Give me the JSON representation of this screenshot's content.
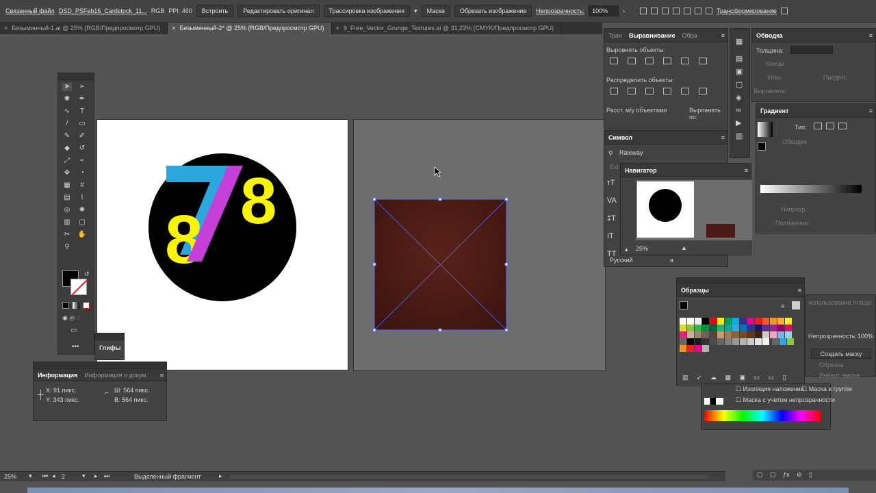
{
  "control_bar": {
    "linked_file": "Связанный файл",
    "file_name": "DSD_PSFeb16_Cardstock_11...",
    "color_mode": "RGB",
    "ppi": "PPI: 460",
    "embed": "Встроить",
    "edit_original": "Редактировать оригинал",
    "image_trace": "Трассировка изображения",
    "mask": "Маска",
    "crop_image": "Обрезать изображение",
    "opacity_label": "Непрозрачность:",
    "opacity_value": "100%",
    "transform": "Трансформирование"
  },
  "tabs": [
    {
      "label": "Безымянный-1.ai @ 25% (RGB/Предпросмотр GPU)",
      "active": false
    },
    {
      "label": "Безымянный-2* @ 25% (RGB/Предпросмотр GPU)",
      "active": true
    },
    {
      "label": "9_Free_Vector_Grunge_Textures.ai @ 31,23% (CMYK/Предпросмотр GPU)",
      "active": false
    }
  ],
  "artboard1": {
    "logo_text_seven": "7",
    "logo_text_eight_a": "8",
    "logo_text_eight_b": "8"
  },
  "glyphs_panel": {
    "title": "Глифы"
  },
  "info_panel": {
    "tab1": "Информация",
    "tab2": "Информация о докум",
    "x": "X:  91 пикс.",
    "y": "Y:  343 пикс.",
    "w": "Ш:  564 пикс.",
    "h": "В:  564 пикс."
  },
  "align_panel": {
    "tab1": "Тран",
    "tab2": "Выравнивание",
    "tab3": "Обра",
    "align_objects": "Выровнять объекты:",
    "distribute_objects": "Распределить объекты:",
    "spacing": "Расст. м/у объектами",
    "align_to": "Выровнять по:"
  },
  "stroke_panel": {
    "title": "Обводка",
    "thickness": "Толщина:",
    "caps": "Концы",
    "corners": "Углы",
    "limit": "Предел:",
    "align": "Выровнять:"
  },
  "gradient_panel": {
    "title": "Градиент",
    "type": "Тип:",
    "stroke": "Обводка",
    "opacity": "Непрозр.:",
    "location": "Положение:"
  },
  "symbol_panel": {
    "title": "Символ",
    "font": "Raleway",
    "ext": "Ext",
    "language": "Русский",
    "aa": "a"
  },
  "navigator_panel": {
    "title": "Навигатор",
    "zoom": "25%"
  },
  "swatches_panel": {
    "title": "Образцы"
  },
  "transparency_panel": {
    "usage_text": "использование плашe",
    "opacity_label": "Непрозрачность:",
    "opacity_value": "100%",
    "make_mask": "Создать маску",
    "clip": "Обрезка",
    "invert": "Инверт. маска",
    "isolate": "Изоляция наложения",
    "knockout": "Маска в группе",
    "opacity_mask": "Маска с учетом непрозрачности"
  },
  "status_bar": {
    "zoom": "25%",
    "artboard": "2",
    "selection": "Выделенный фрагмент"
  },
  "colors": {
    "cyan": "#2aa7dd",
    "magenta": "#c63fd8",
    "yellow": "#fbf504",
    "texture": "#4a1a14",
    "selection": "#4f6bff"
  }
}
